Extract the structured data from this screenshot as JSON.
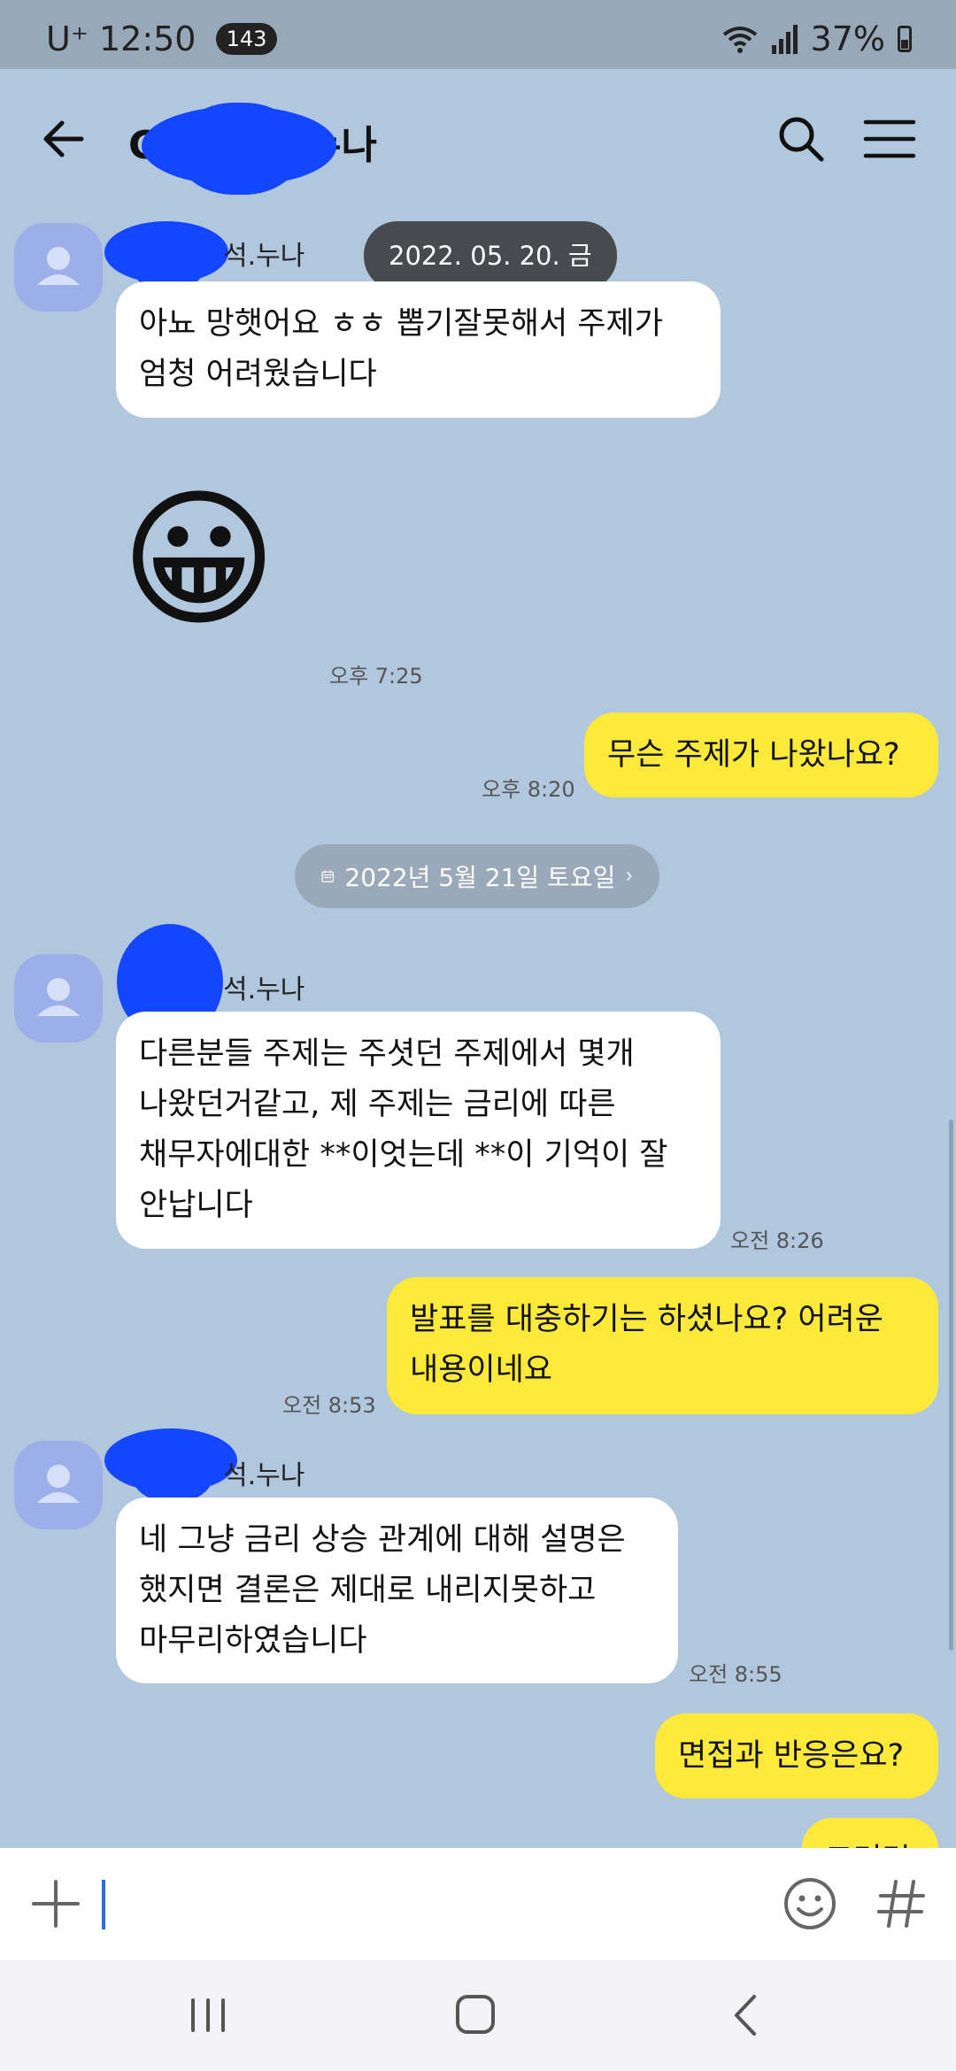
{
  "status": {
    "carrier": "U⁺",
    "time": "12:50",
    "badge": "143",
    "battery": "37%"
  },
  "header": {
    "title": "승석.누나",
    "title_prefix": "C"
  },
  "sender_suffix": "석.누나",
  "date_chip": "2022. 05. 20. 금",
  "date_divider": "2022년 5월 21일 토요일",
  "messages": [
    {
      "text": "아뇨 망햇어요 ㅎㅎ 뽑기잘못해서 주제가\n엄청 어려웠습니다"
    },
    {
      "emoji": "😀",
      "time": "오후 7:25"
    },
    {
      "text": "무슨 주제가 나왔나요?",
      "time": "오후 8:20"
    },
    {
      "text": "다른분들 주제는 주셧던 주제에서 몇개\n나왔던거같고, 제 주제는 금리에 따른\n채무자에대한 **이엇는데 **이 기억이 잘\n안납니다",
      "time": "오전 8:26"
    },
    {
      "text": "발표를 대충하기는 하셨나요? 어려운\n내용이네요",
      "time": "오전 8:53"
    },
    {
      "text": "네 그냥 금리 상승 관계에 대해 설명은\n했지면 결론은 제대로 내리지못하고\n마무리하였습니다",
      "time": "오전 8:55"
    },
    {
      "text": "면접과 반응은요?"
    },
    {
      "text": "그러면"
    }
  ],
  "colors": {
    "background": "#b0c7dd",
    "bubble_out": "#fde93a",
    "bubble_in": "#ffffff",
    "redaction": "#1446ff"
  }
}
